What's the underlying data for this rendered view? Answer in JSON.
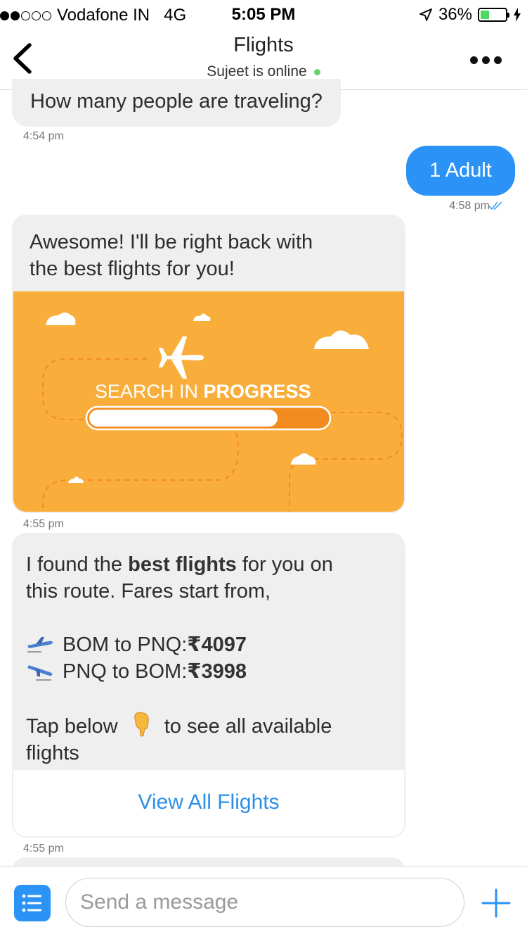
{
  "status_bar": {
    "carrier": "Vodafone IN",
    "network": "4G",
    "time": "5:05 PM",
    "battery": "36%",
    "battery_level": 0.36,
    "signal_bars_filled": 2,
    "signal_bars_total": 5
  },
  "nav": {
    "title": "Flights",
    "subtitle": "Sujeet is online",
    "online_color": "#6ad16b"
  },
  "messages": {
    "m1": {
      "text": "How many people are traveling?",
      "time": "4:54 pm"
    },
    "m2": {
      "text": "1 Adult",
      "time": "4:58 pm"
    },
    "m3": {
      "line1": "Awesome! I'll be right back with",
      "line2": "the best flights for you!",
      "banner_text_light": "SEARCH IN ",
      "banner_text_bold": "PROGRESS",
      "progress": 0.79,
      "time": "4:55 pm"
    },
    "m4": {
      "intro_a": "I found the ",
      "intro_bold": "best flights",
      "intro_b": " for you on",
      "intro_c": "this route. Fares start from,",
      "route1_label": "BOM to PNQ: ",
      "route1_price": "₹4097",
      "route2_label": "PNQ to BOM: ",
      "route2_price": "₹3998",
      "cta_a": "Tap below",
      "cta_b": "to see all available",
      "cta_c": "flights",
      "button": "View All Flights",
      "time": "4:55 pm"
    }
  },
  "composer": {
    "placeholder": "Send a message"
  },
  "colors": {
    "accent": "#2b93f5",
    "banner": "#f9ae3c",
    "bubble_in": "#efefef"
  }
}
